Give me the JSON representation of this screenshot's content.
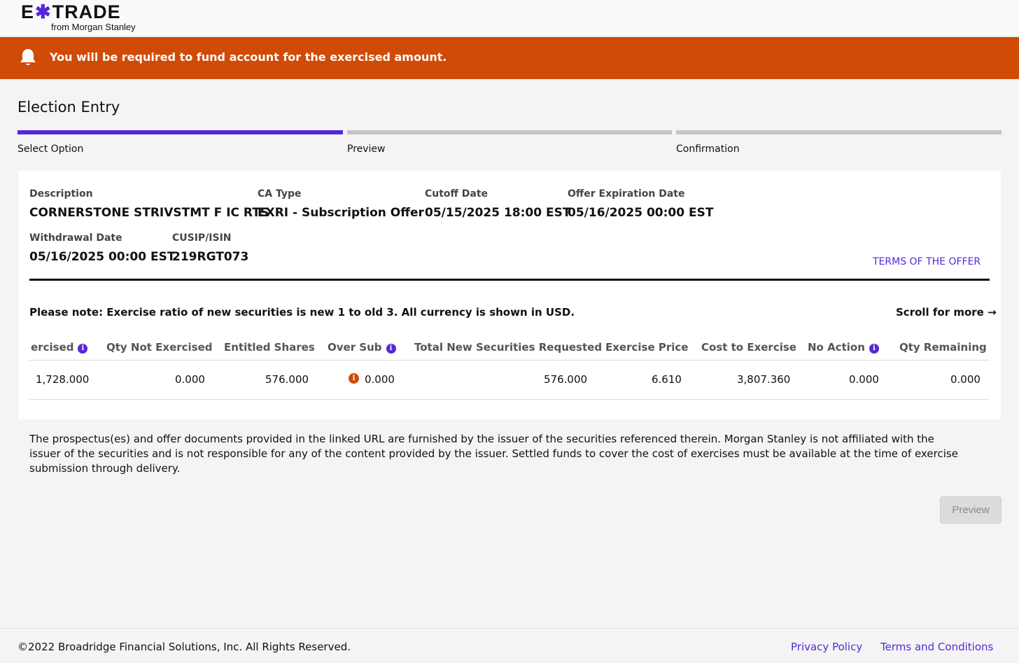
{
  "header": {
    "logo_left": "E",
    "logo_x": "✱",
    "logo_right": "TRADE",
    "logo_sub": "from Morgan Stanley"
  },
  "alert": {
    "icon": "bell-icon",
    "message": "You will be required to fund account for the exercised amount."
  },
  "page": {
    "title": "Election Entry"
  },
  "steps": [
    {
      "label": "Select Option",
      "active": true
    },
    {
      "label": "Preview",
      "active": false
    },
    {
      "label": "Confirmation",
      "active": false
    }
  ],
  "details": {
    "description_label": "Description",
    "description_value": "CORNERSTONE STRIVSTMT F IC RTS",
    "ca_type_label": "CA Type",
    "ca_type_value": "EXRI - Subscription Offer",
    "cutoff_label": "Cutoff Date",
    "cutoff_value": "05/15/2025 18:00 EST",
    "offer_exp_label": "Offer Expiration Date",
    "offer_exp_value": "05/16/2025 00:00 EST",
    "withdrawal_label": "Withdrawal Date",
    "withdrawal_value": "05/16/2025 00:00 EST",
    "cusip_label": "CUSIP/ISIN",
    "cusip_value": "219RGT073",
    "terms_link": "TERMS OF THE OFFER"
  },
  "table": {
    "note": "Please note: Exercise ratio of new securities is new 1 to old 3. All currency is shown in USD.",
    "scroll_more": "Scroll for more →",
    "headers": [
      "ercised",
      "Qty Not Exercised",
      "Entitled Shares",
      "Over Sub",
      "Total New Securities Requested",
      "Exercise Price",
      "Cost to Exercise",
      "No Action",
      "Qty Remaining"
    ],
    "row": [
      "1,728.000",
      "0.000",
      "576.000",
      "0.000",
      "576.000",
      "6.610",
      "3,807.360",
      "0.000",
      "0.000"
    ],
    "info_glyph": "i"
  },
  "disclaimer": "The prospectus(es) and offer documents provided in the linked URL are furnished by the issuer of the securities referenced therein. Morgan Stanley is not affiliated with the issuer of the securities and is not responsible for any of the content provided by the issuer. Settled funds to cover the cost of exercises must be available at the time of exercise submission through delivery.",
  "actions": {
    "preview_label": "Preview"
  },
  "footer": {
    "copyright": "©2022 Broadridge Financial Solutions, Inc. All Rights Reserved.",
    "privacy": "Privacy Policy",
    "terms": "Terms and Conditions"
  },
  "colors": {
    "accent": "#5627d8",
    "alert": "#d04b07",
    "step_inactive": "#c4c4c4"
  }
}
